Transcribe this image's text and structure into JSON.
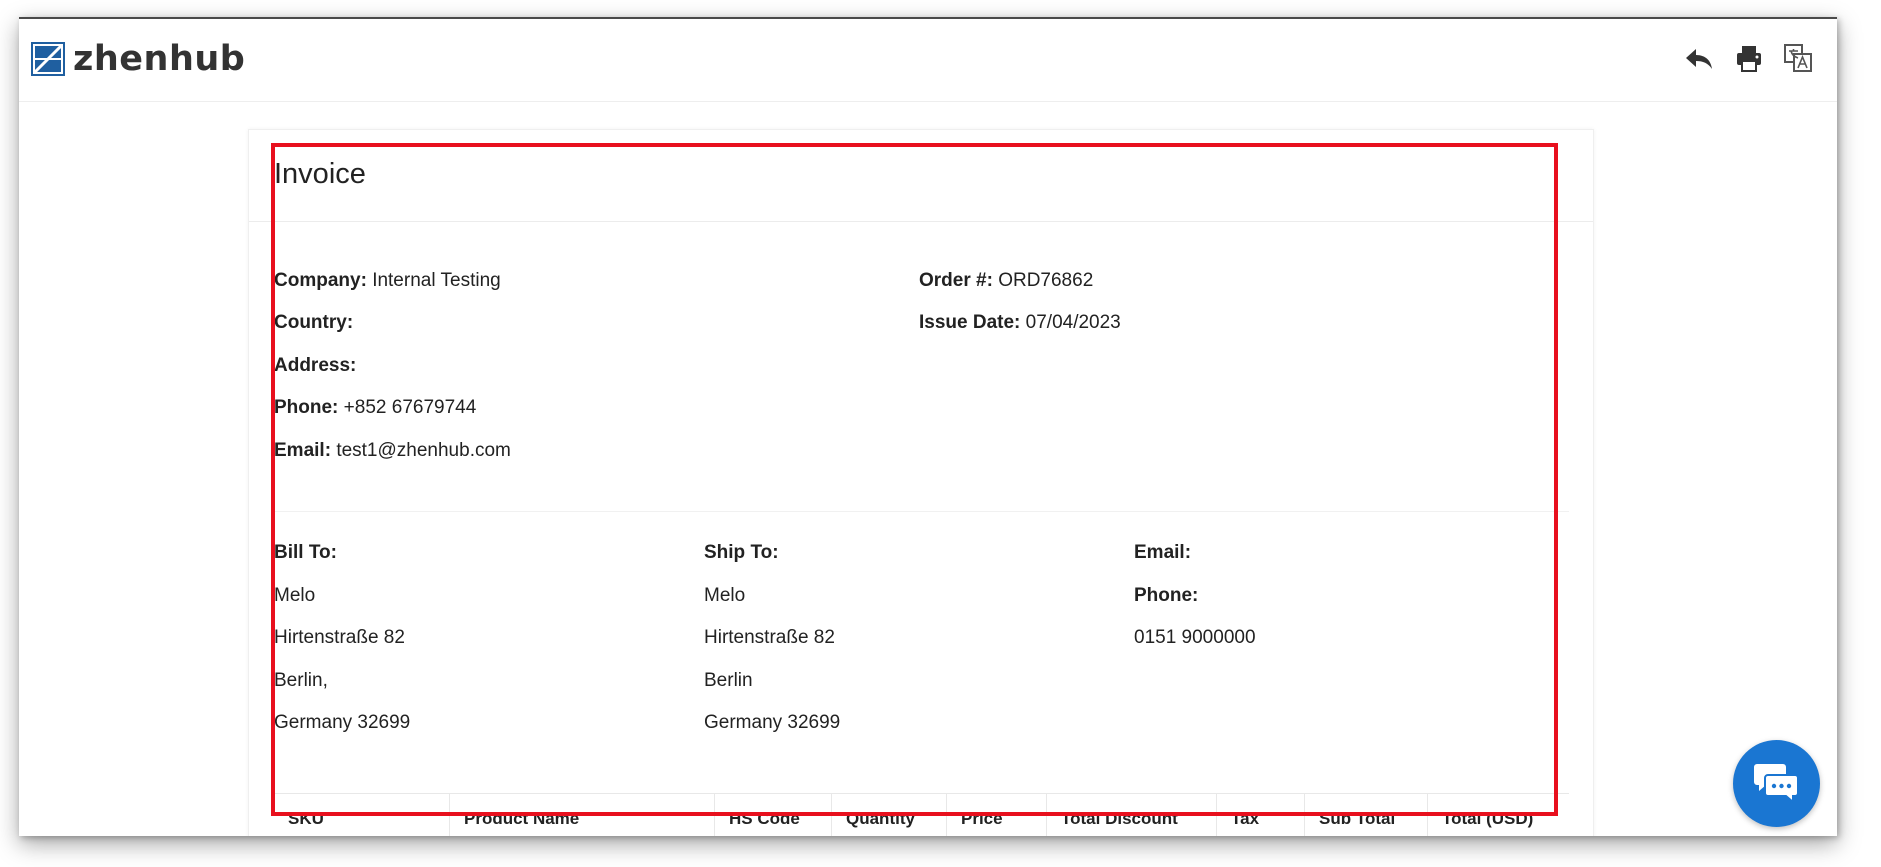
{
  "brand": {
    "name": "zhenhub",
    "color": "#1f5fa0"
  },
  "toolbar": {
    "icons": [
      "reply-icon",
      "print-icon",
      "translate-icon"
    ]
  },
  "invoice": {
    "title": "Invoice",
    "company": {
      "label": "Company:",
      "value": "Internal Testing"
    },
    "country": {
      "label": "Country:",
      "value": ""
    },
    "address": {
      "label": "Address:",
      "value": ""
    },
    "phone": {
      "label": "Phone:",
      "value": "+852 67679744"
    },
    "email": {
      "label": "Email:",
      "value": "test1@zhenhub.com"
    },
    "order": {
      "label": "Order #:",
      "value": "ORD76862"
    },
    "issue_date": {
      "label": "Issue Date:",
      "value": "07/04/2023"
    }
  },
  "bill_to": {
    "label": "Bill To:",
    "lines": [
      "Melo",
      "Hirtenstraße 82",
      "Berlin,",
      "Germany 32699"
    ]
  },
  "ship_to": {
    "label": "Ship To:",
    "lines": [
      "Melo",
      "Hirtenstraße 82",
      "Berlin",
      "Germany 32699"
    ]
  },
  "contact": {
    "email_label": "Email:",
    "phone_label": "Phone:",
    "phone_value": "0151 9000000"
  },
  "table": {
    "headers": [
      "SKU",
      "Product Name",
      "HS Code",
      "Quantity",
      "Price",
      "Total Discount",
      "Tax",
      "Sub Total",
      "Total (USD)"
    ]
  },
  "chat": {
    "icon": "chat-bubbles-icon",
    "color": "#1a76d2"
  },
  "highlight_color": "#e8101e"
}
